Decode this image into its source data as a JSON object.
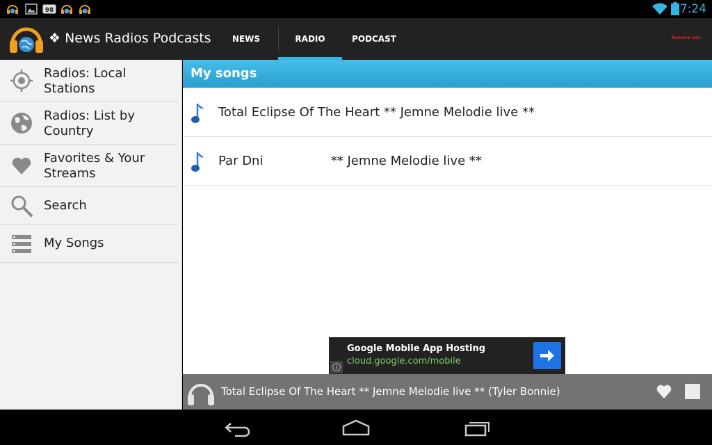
{
  "status_bar": {
    "time": "7:24",
    "notification_badge": "98",
    "icons": [
      "headphones-globe-icon",
      "image-icon",
      "badge-98-icon",
      "headphones-globe-icon",
      "headphones-globe-icon",
      "wifi-icon",
      "battery-icon"
    ]
  },
  "app": {
    "title": "❖ News Radios Podcasts",
    "tabs": [
      {
        "label": "NEWS",
        "active": false
      },
      {
        "label": "RADIO",
        "active": true
      },
      {
        "label": "PODCAST",
        "active": false
      }
    ],
    "remove_ads": "Remove ads",
    "accent": "#33b5e5"
  },
  "sidebar": {
    "items": [
      {
        "label": "Radios: Local Stations",
        "icon": "location-target-icon"
      },
      {
        "label": "Radios: List by Country",
        "icon": "globe-icon"
      },
      {
        "label": "Favorites & Your Streams",
        "icon": "heart-icon"
      },
      {
        "label": "Search",
        "icon": "search-icon"
      },
      {
        "label": "My Songs",
        "icon": "list-icon"
      }
    ]
  },
  "main": {
    "title": "My songs",
    "songs": [
      {
        "title": "Total Eclipse Of The Heart ** Jemne Melodie live **",
        "icon": "music-note-icon"
      },
      {
        "title": "Par Dni                 ** Jemne Melodie live **",
        "icon": "music-note-icon"
      }
    ]
  },
  "ad": {
    "title": "Google Mobile App Hosting",
    "url": "cloud.google.com/mobile",
    "button_color": "#1e73e6"
  },
  "player": {
    "track": "Total Eclipse Of The Heart ** Jemne Melodie live ** (Tyler Bonnie)",
    "icon": "headphones-icon"
  },
  "navbar": {
    "buttons": [
      "back-icon",
      "home-icon",
      "recent-apps-icon"
    ]
  }
}
